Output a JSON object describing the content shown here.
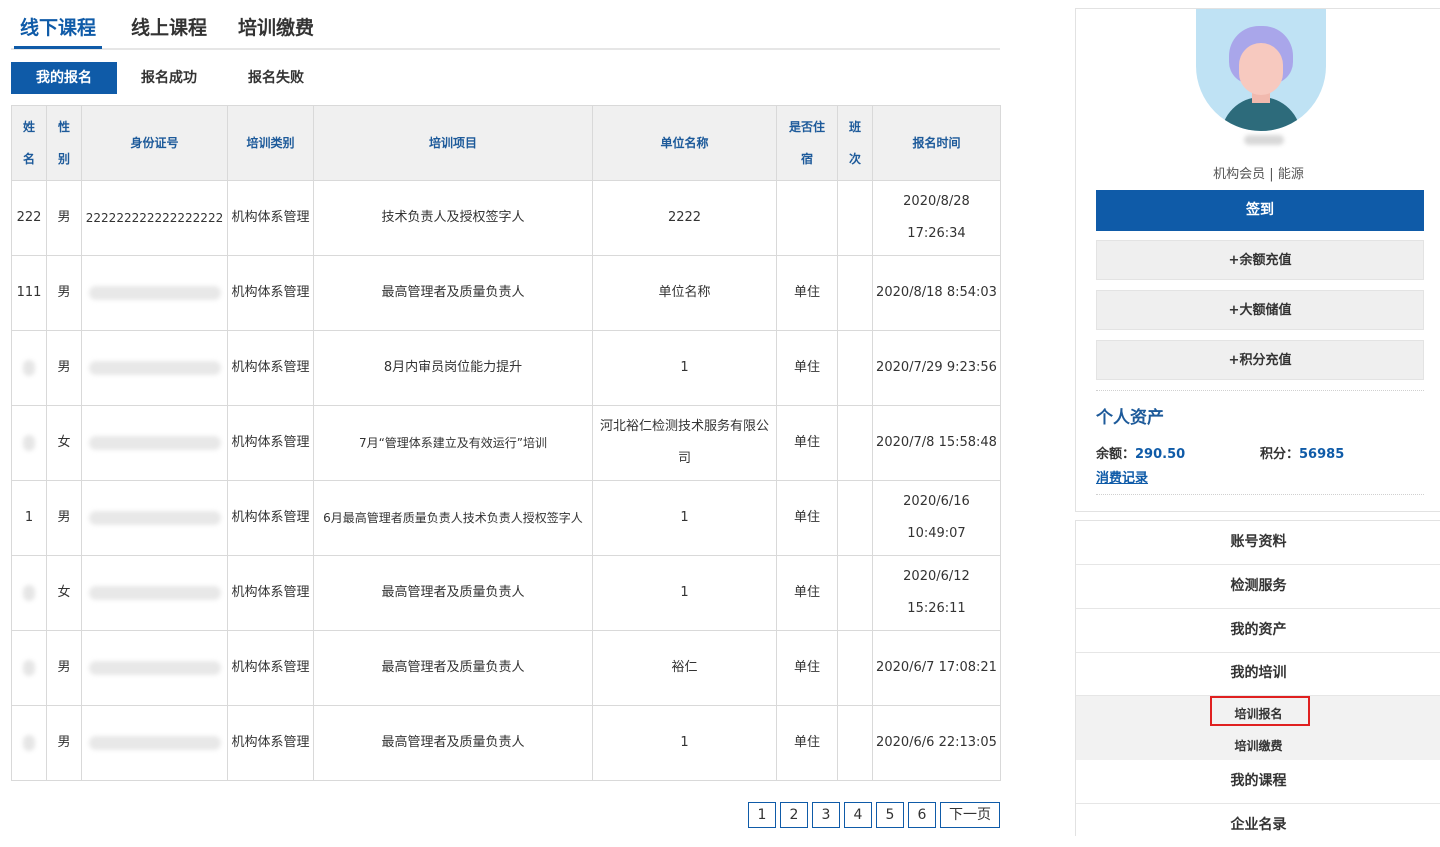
{
  "top_tabs": [
    "线下课程",
    "线上课程",
    "培训缴费"
  ],
  "sub_tabs": [
    "我的报名",
    "报名成功",
    "报名失败"
  ],
  "table": {
    "headers": [
      "姓名",
      "性别",
      "身份证号",
      "培训类别",
      "培训项目",
      "单位名称",
      "是否住宿",
      "班次",
      "报名时间"
    ],
    "rows": [
      {
        "name": "222",
        "gender": "男",
        "id": "222222222222222222",
        "category": "机构体系管理",
        "project": "技术负责人及授权签字人",
        "unit": "2222",
        "lodging": "",
        "shift": "",
        "time": "2020/8/28 17:26:34"
      },
      {
        "name": "111",
        "gender": "男",
        "id": "",
        "category": "机构体系管理",
        "project": "最高管理者及质量负责人",
        "unit": "单位名称",
        "lodging": "单住",
        "shift": "",
        "time": "2020/8/18 8:54:03"
      },
      {
        "name": "",
        "gender": "男",
        "id": "",
        "category": "机构体系管理",
        "project": "8月内审员岗位能力提升",
        "unit": "1",
        "lodging": "单住",
        "shift": "",
        "time": "2020/7/29 9:23:56"
      },
      {
        "name": "",
        "gender": "女",
        "id": "",
        "category": "机构体系管理",
        "project": "7月“管理体系建立及有效运行”培训",
        "unit": "河北裕仁检测技术服务有限公司",
        "lodging": "单住",
        "shift": "",
        "time": "2020/7/8 15:58:48"
      },
      {
        "name": "1",
        "gender": "男",
        "id": "",
        "category": "机构体系管理",
        "project": "6月最高管理者质量负责人技术负责人授权签字人",
        "unit": "1",
        "lodging": "单住",
        "shift": "",
        "time": "2020/6/16 10:49:07"
      },
      {
        "name": "",
        "gender": "女",
        "id": "",
        "category": "机构体系管理",
        "project": "最高管理者及质量负责人",
        "unit": "1",
        "lodging": "单住",
        "shift": "",
        "time": "2020/6/12 15:26:11"
      },
      {
        "name": "",
        "gender": "男",
        "id": "",
        "category": "机构体系管理",
        "project": "最高管理者及质量负责人",
        "unit": "裕仁",
        "lodging": "单住",
        "shift": "",
        "time": "2020/6/7 17:08:21"
      },
      {
        "name": "",
        "gender": "男",
        "id": "",
        "category": "机构体系管理",
        "project": "最高管理者及质量负责人",
        "unit": "1",
        "lodging": "单住",
        "shift": "",
        "time": "2020/6/6 22:13:05"
      }
    ]
  },
  "pagination": {
    "pages": [
      "1",
      "2",
      "3",
      "4",
      "5",
      "6"
    ],
    "next": "下一页"
  },
  "sidebar": {
    "member": "机构会员 | 能源",
    "sign_in": "签到",
    "balance_recharge": "+余额充值",
    "large_deposit": "+大额储值",
    "points_recharge": "+积分充值",
    "assets_title": "个人资产",
    "balance_label": "余额：",
    "balance_value": "290.50",
    "points_label": "积分：",
    "points_value": "56985",
    "records": "消费记录"
  },
  "menu": {
    "items": [
      "账号资料",
      "检测服务",
      "我的资产",
      "我的培训"
    ],
    "sub_items": [
      "培训报名",
      "培训缴费"
    ],
    "items_after": [
      "我的课程",
      "企业名录"
    ]
  },
  "colors": {
    "primary": "#0f5ba8",
    "header_text": "#1d5a9a",
    "highlight_border": "#e02020"
  }
}
